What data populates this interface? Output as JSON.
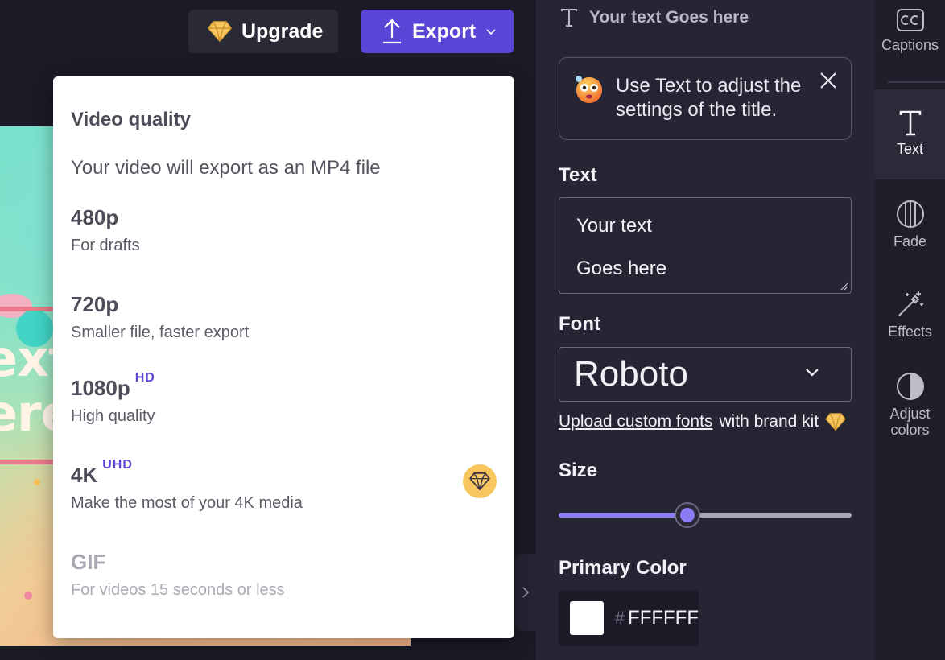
{
  "header": {
    "upgrade_label": "Upgrade",
    "export_label": "Export"
  },
  "export_menu": {
    "heading": "Video quality",
    "subheading": "Your video will export as an MP4 file",
    "options": [
      {
        "title": "480p",
        "badge": "",
        "description": "For drafts",
        "disabled": false
      },
      {
        "title": "720p",
        "badge": "",
        "description": "Smaller file, faster export",
        "disabled": false
      },
      {
        "title": "1080p",
        "badge": "HD",
        "description": "High quality",
        "disabled": false
      },
      {
        "title": "4K",
        "badge": "UHD",
        "description": "Make the most of your 4K media",
        "disabled": false,
        "premium": true
      },
      {
        "title": "GIF",
        "badge": "",
        "description": "For videos 15 seconds or less",
        "disabled": true
      }
    ]
  },
  "preview": {
    "lines": [
      "ext",
      "ere"
    ]
  },
  "properties": {
    "title_preview": "Your text Goes here",
    "tip": "Use Text to adjust the settings of the title.",
    "text_label": "Text",
    "text_lines": [
      "Your text",
      "Goes here"
    ],
    "font_label": "Font",
    "font_value": "Roboto",
    "brand_kit_link": "Upload custom fonts",
    "brand_kit_suffix": "with brand kit",
    "size_label": "Size",
    "size_fraction": 0.44,
    "primary_color_label": "Primary Color",
    "color_hash": "#",
    "color_hex": "FFFFFF",
    "color_value": "#FFFFFF"
  },
  "rail": {
    "items": [
      {
        "label": "Captions",
        "icon": "captions-icon"
      },
      {
        "label": "Text",
        "icon": "text-icon",
        "active": true
      },
      {
        "label": "Fade",
        "icon": "fade-icon"
      },
      {
        "label": "Effects",
        "icon": "effects-icon"
      },
      {
        "label": "Adjust colors",
        "icon": "adjust-colors-icon"
      }
    ]
  },
  "colors": {
    "accent": "#5a46d6",
    "slider": "#8b7cf5",
    "premium": "#f7c65e",
    "badge": "#5b46d4"
  }
}
